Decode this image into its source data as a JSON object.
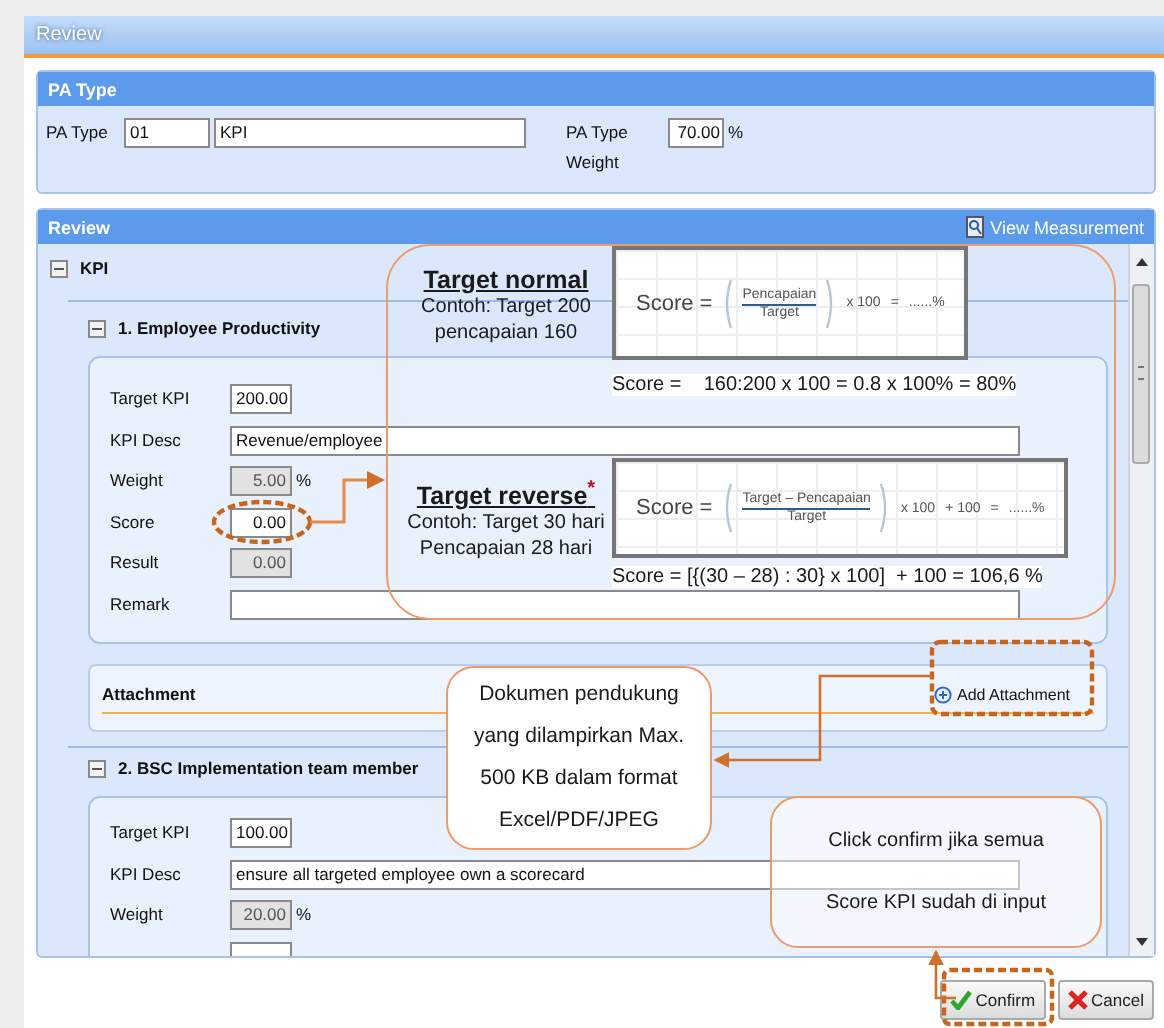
{
  "window": {
    "title": "Review"
  },
  "pa_type_panel": {
    "title": "PA Type",
    "label": "PA Type",
    "code": "01",
    "name": "KPI",
    "weight_label": "PA Type Weight",
    "weight": "70.00",
    "unit": "%"
  },
  "review_panel": {
    "title": "Review",
    "view_link": "View Measurement",
    "groups": [
      {
        "label": "KPI",
        "expanded": true,
        "items": [
          {
            "title": "1. Employee Productivity",
            "expanded": true,
            "fields": [
              {
                "label": "Target KPI",
                "value": "200.00",
                "kind": "short"
              },
              {
                "label": "KPI Desc",
                "value": "Revenue/employee",
                "kind": "wide"
              },
              {
                "label": "Weight",
                "value": "5.00",
                "unit": "%",
                "kind": "readonly"
              },
              {
                "label": "Score",
                "value": "0.00",
                "kind": "short"
              },
              {
                "label": "Result",
                "value": "0.00",
                "kind": "readonly"
              },
              {
                "label": "Remark",
                "kind": "wide"
              }
            ],
            "attachment": {
              "title": "Attachment",
              "link": "Add Attachment"
            }
          },
          {
            "title": "2. BSC Implementation team member",
            "expanded": true,
            "fields": [
              {
                "label": "Target KPI",
                "value": "100.00",
                "kind": "short"
              },
              {
                "label": "KPI Desc",
                "value": "ensure all targeted employee own a scorecard",
                "kind": "wide"
              },
              {
                "label": "Weight",
                "value": "20.00",
                "unit": "%",
                "kind": "readonly"
              },
              {
                "kind": "short"
              }
            ]
          }
        ]
      }
    ]
  },
  "buttons": [
    {
      "label": "Confirm",
      "kind": "confirm"
    },
    {
      "label": "Cancel",
      "kind": "cancel"
    }
  ],
  "annotations": {
    "formula_note": [
      {
        "title": "Target normal",
        "example": [
          "Contoh: Target 200",
          "pencapaian 160"
        ],
        "formula": {
          "lhs": "Score =",
          "numerator": "Pencapaian",
          "denominator": "Target",
          "terms": [
            "x 100",
            "=",
            "......%"
          ]
        },
        "result": "Score =    160:200 x 100 = 0.8 x 100% = 80%"
      },
      {
        "title": "Target reverse",
        "required_mark": "*",
        "example": [
          "Contoh: Target 30 hari",
          "Pencapaian 28 hari"
        ],
        "formula": {
          "lhs": "Score =",
          "numerator": "Target – Pencapaian",
          "denominator": "Target",
          "terms": [
            "x 100",
            "+ 100",
            "=",
            "......%"
          ]
        },
        "result": "Score = [{(30 – 28) : 30} x 100]  + 100 = 106,6 %"
      }
    ],
    "attachment_note": "Dokumen pendukung yang dilampirkan Max. 500 KB dalam format Excel/PDF/JPEG",
    "confirm_note": "Click confirm jika semua Score KPI sudah di input"
  }
}
